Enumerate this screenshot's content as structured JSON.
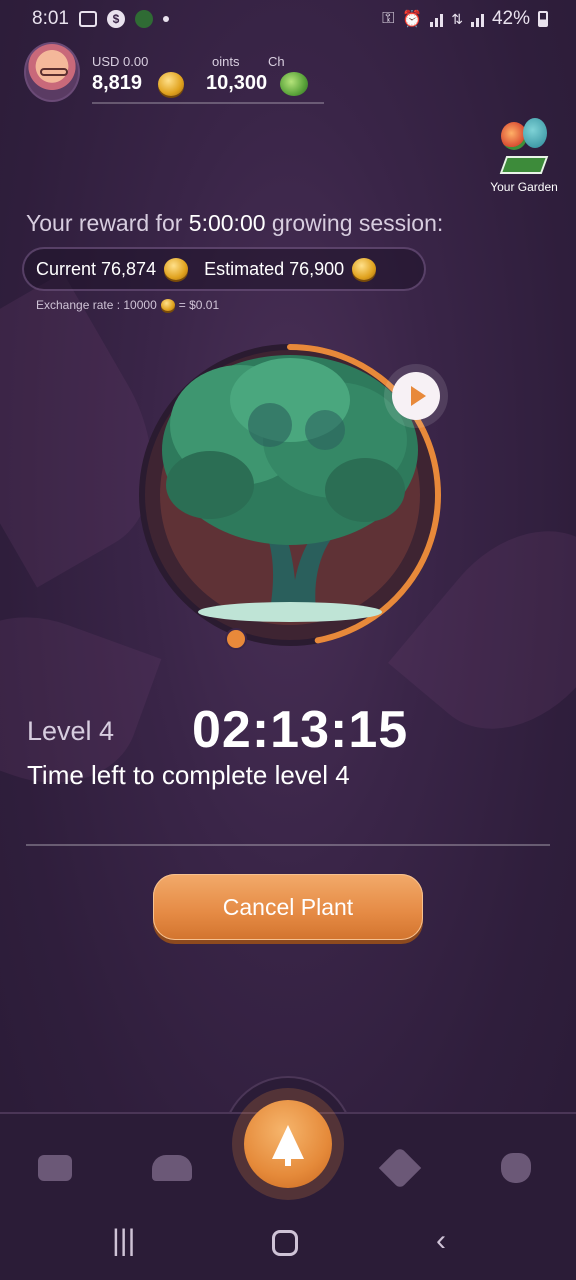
{
  "status_bar": {
    "time": "8:01",
    "battery": "42%"
  },
  "header": {
    "usd_label": "USD 0.00",
    "usd_value": "8,819",
    "points_label": "oints",
    "points_value": "10,300",
    "third_label": "Ch"
  },
  "garden": {
    "label": "Your Garden"
  },
  "reward": {
    "title_prefix": "Your reward for ",
    "duration": "5:00:00",
    "title_suffix": " growing session:",
    "current_label": "Current 76,874",
    "estimated_label": "Estimated 76,900",
    "exchange_prefix": "Exchange rate : 10000",
    "exchange_suffix": "= $0.01"
  },
  "session": {
    "level_label": "Level 4",
    "timer": "02:13:15",
    "time_left_text": "Time left to complete level 4",
    "progress_fraction": 0.47
  },
  "actions": {
    "cancel_label": "Cancel Plant"
  },
  "bottom_nav": {
    "items": [
      "wallet-icon",
      "friends-icon",
      "handshake-heart-icon",
      "money-bag-icon"
    ],
    "center": "tree-icon"
  },
  "colors": {
    "accent": "#e58a3a",
    "background": "#3a2548",
    "nav": "#2b1c37"
  }
}
